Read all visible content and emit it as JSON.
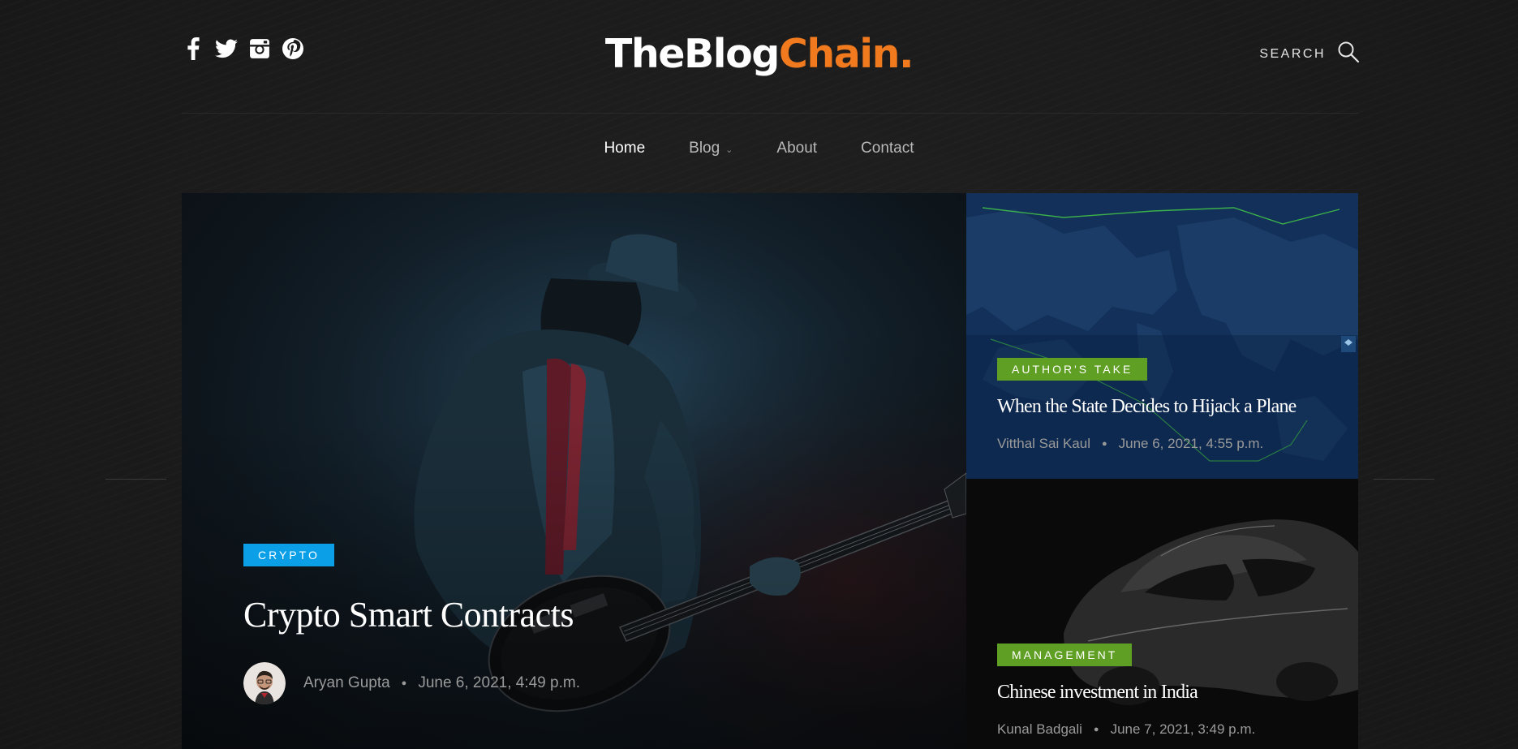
{
  "site": {
    "logo_part1": "TheBlog",
    "logo_part2": "Chain.",
    "search_label": "SEARCH"
  },
  "social": [
    "facebook-icon",
    "twitter-icon",
    "instagram-icon",
    "pinterest-icon"
  ],
  "nav": {
    "items": [
      {
        "label": "Home",
        "active": true
      },
      {
        "label": "Blog",
        "has_dropdown": true
      },
      {
        "label": "About"
      },
      {
        "label": "Contact"
      }
    ]
  },
  "featured": {
    "category": "CRYPTO",
    "title": "Crypto Smart Contracts",
    "author": "Aryan Gupta",
    "date": "June 6, 2021, 4:49 p.m."
  },
  "cards": [
    {
      "category": "AUTHOR'S TAKE",
      "title": "When the State Decides to Hijack a Plane",
      "author": "Vitthal Sai Kaul",
      "date": "June 6, 2021, 4:55 p.m."
    },
    {
      "category": "MANAGEMENT",
      "title": "Chinese investment in India",
      "author": "Kunal Badgali",
      "date": "June 7, 2021, 3:49 p.m."
    }
  ],
  "colors": {
    "accent_orange": "#f07a1d",
    "badge_blue": "#0a9fe6",
    "badge_green": "#5f9f23",
    "background": "#1b1b1b"
  }
}
